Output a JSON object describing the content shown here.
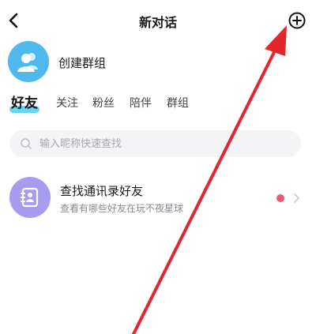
{
  "header": {
    "title": "新对话"
  },
  "icons": {
    "back": "chevron-left-icon",
    "new": "plus-circle-icon"
  },
  "create_group": {
    "label": "创建群组",
    "avatar_color": "#4fb8ec"
  },
  "tabs": [
    {
      "label": "好友",
      "active": true
    },
    {
      "label": "关注"
    },
    {
      "label": "粉丝"
    },
    {
      "label": "陪伴"
    },
    {
      "label": "群组"
    }
  ],
  "search": {
    "placeholder": "输入昵称快速查找",
    "value": ""
  },
  "contacts_entry": {
    "title": "查找通讯录好友",
    "subtitle": "查看有哪些好友在玩不夜星球",
    "avatar_color": "#a79cf0",
    "badge_color": "#ef5a6a"
  },
  "colors": {
    "tab_highlight": "#67d6ee",
    "annotation_arrow": "#e3262c"
  }
}
